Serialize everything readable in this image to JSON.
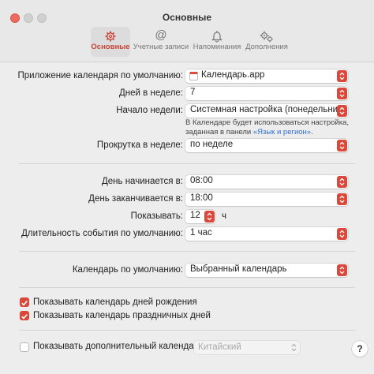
{
  "window": {
    "title": "Основные"
  },
  "tabs": [
    {
      "label": "Основные",
      "icon": "gear-icon",
      "active": true
    },
    {
      "label": "Учетные записи",
      "icon": "at-icon",
      "active": false
    },
    {
      "label": "Напоминания",
      "icon": "bell-icon",
      "active": false
    },
    {
      "label": "Дополнения",
      "icon": "gears-icon",
      "active": false
    }
  ],
  "settings": {
    "default_app": {
      "label": "Приложение календаря по умолчанию:",
      "value": "Календарь.app",
      "icon": "calendar-app-icon"
    },
    "days_per_week": {
      "label": "Дней в неделе:",
      "value": "7"
    },
    "week_start": {
      "label": "Начало недели:",
      "value": "Системная настройка (понедельник)"
    },
    "note": {
      "text1": "В Календаре будет использоваться настройка,",
      "text2": "заданная в панели",
      "link": "«Язык и регион»",
      "end": "."
    },
    "scroll": {
      "label": "Прокрутка в неделе:",
      "value": "по неделе"
    },
    "day_start": {
      "label": "День начинается в:",
      "value": "08:00"
    },
    "day_end": {
      "label": "День заканчивается в:",
      "value": "18:00"
    },
    "show_hours": {
      "label": "Показывать:",
      "value": "12",
      "unit": "ч"
    },
    "event_duration": {
      "label": "Длительность события по умолчанию:",
      "value": "1 час"
    },
    "default_calendar": {
      "label": "Календарь по умолчанию:",
      "value": "Выбранный календарь"
    }
  },
  "checkboxes": {
    "birthdays": {
      "label": "Показывать календарь дней рождения",
      "checked": true
    },
    "holidays": {
      "label": "Показывать календарь праздничных дней",
      "checked": true
    },
    "extra": {
      "label": "Показывать дополнительный календарь:",
      "checked": false,
      "value": "Китайский"
    }
  },
  "help": {
    "label": "?"
  },
  "colors": {
    "accent": "#d9483b",
    "link": "#2f6fd1"
  }
}
